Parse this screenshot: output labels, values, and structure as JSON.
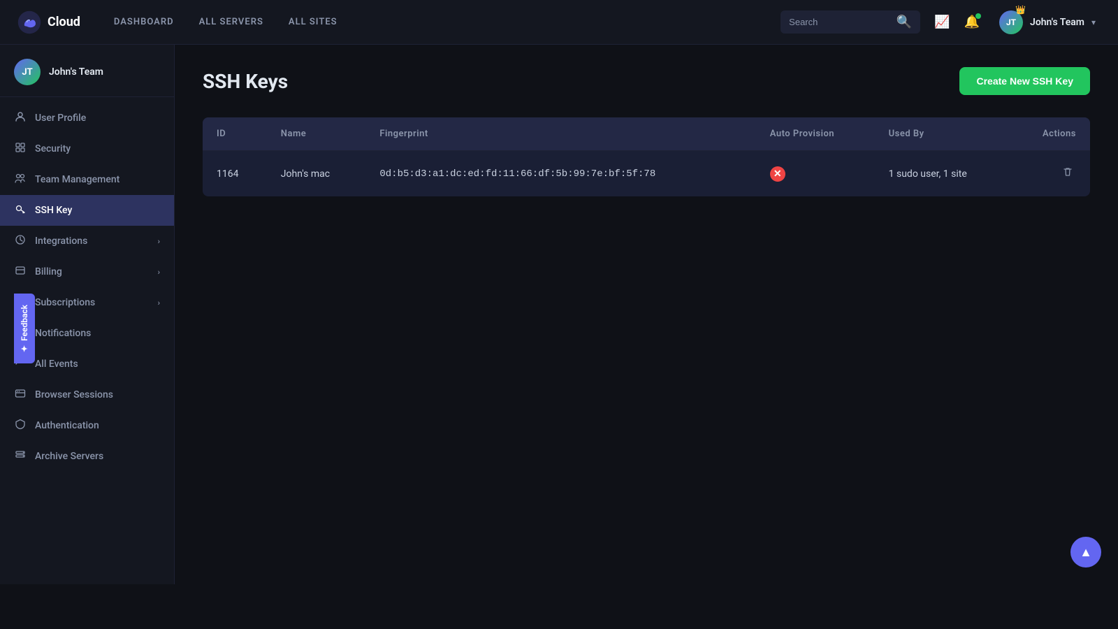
{
  "nav": {
    "logo_text": "Cloud",
    "links": [
      "DASHBOARD",
      "ALL SERVERS",
      "ALL SITES"
    ],
    "search_placeholder": "Search",
    "user_name": "John's Team",
    "user_initials": "JT"
  },
  "sidebar": {
    "user_name": "John's Team",
    "user_initials": "JT",
    "items": [
      {
        "id": "user-profile",
        "label": "User Profile",
        "icon": "👤",
        "has_chevron": false
      },
      {
        "id": "security",
        "label": "Security",
        "icon": "⚙",
        "has_chevron": false
      },
      {
        "id": "team-management",
        "label": "Team Management",
        "icon": "👥",
        "has_chevron": false
      },
      {
        "id": "ssh-key",
        "label": "SSH Key",
        "icon": "🔑",
        "has_chevron": false,
        "active": true
      },
      {
        "id": "integrations",
        "label": "Integrations",
        "icon": "⚙",
        "has_chevron": true
      },
      {
        "id": "billing",
        "label": "Billing",
        "icon": "📄",
        "has_chevron": true
      },
      {
        "id": "subscriptions",
        "label": "Subscriptions",
        "icon": "📋",
        "has_chevron": true
      },
      {
        "id": "notifications",
        "label": "Notifications",
        "icon": "🔔",
        "has_chevron": false
      },
      {
        "id": "all-events",
        "label": "All Events",
        "icon": "📊",
        "has_chevron": false
      },
      {
        "id": "browser-sessions",
        "label": "Browser Sessions",
        "icon": "💻",
        "has_chevron": false
      },
      {
        "id": "authentication",
        "label": "Authentication",
        "icon": "🛡",
        "has_chevron": false
      },
      {
        "id": "archive-servers",
        "label": "Archive Servers",
        "icon": "🗄",
        "has_chevron": false
      }
    ]
  },
  "page": {
    "title": "SSH Keys",
    "create_button": "Create New SSH Key"
  },
  "table": {
    "headers": [
      "ID",
      "Name",
      "Fingerprint",
      "Auto Provision",
      "Used By",
      "Actions"
    ],
    "rows": [
      {
        "id": "1164",
        "name": "John's mac",
        "fingerprint": "0d:b5:d3:a1:dc:ed:fd:11:66:df:5b:99:7e:bf:5f:78",
        "auto_provision": false,
        "used_by": "1 sudo user, 1 site"
      }
    ]
  },
  "feedback": {
    "label": "Feedback",
    "icon": "✦"
  }
}
